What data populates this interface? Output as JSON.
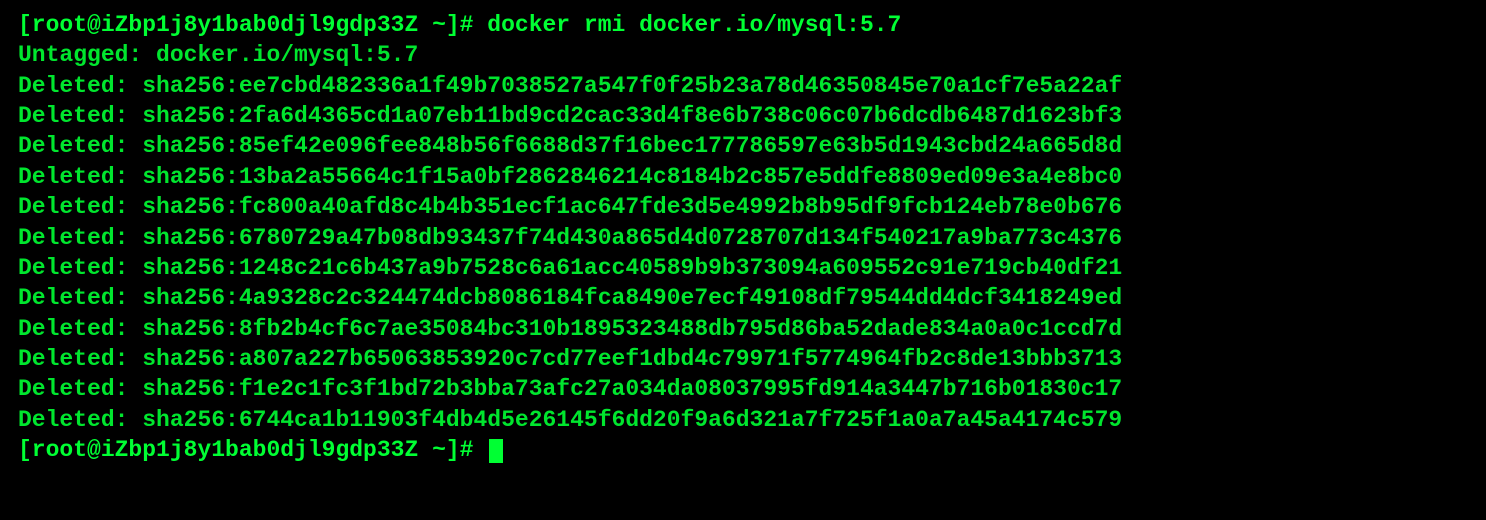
{
  "prompt": "[root@iZbp1j8y1bab0djl9gdp33Z ~]# ",
  "command": "docker rmi docker.io/mysql:5.7",
  "untagged_label": "Untagged: ",
  "untagged_value": "docker.io/mysql:5.7",
  "deleted_label": "Deleted: ",
  "deleted": [
    "sha256:ee7cbd482336a1f49b7038527a547f0f25b23a78d46350845e70a1cf7e5a22af",
    "sha256:2fa6d4365cd1a07eb11bd9cd2cac33d4f8e6b738c06c07b6dcdb6487d1623bf3",
    "sha256:85ef42e096fee848b56f6688d37f16bec177786597e63b5d1943cbd24a665d8d",
    "sha256:13ba2a55664c1f15a0bf2862846214c8184b2c857e5ddfe8809ed09e3a4e8bc0",
    "sha256:fc800a40afd8c4b4b351ecf1ac647fde3d5e4992b8b95df9fcb124eb78e0b676",
    "sha256:6780729a47b08db93437f74d430a865d4d0728707d134f540217a9ba773c4376",
    "sha256:1248c21c6b437a9b7528c6a61acc40589b9b373094a609552c91e719cb40df21",
    "sha256:4a9328c2c324474dcb8086184fca8490e7ecf49108df79544dd4dcf3418249ed",
    "sha256:8fb2b4cf6c7ae35084bc310b1895323488db795d86ba52dade834a0a0c1ccd7d",
    "sha256:a807a227b65063853920c7cd77eef1dbd4c79971f5774964fb2c8de13bbb3713",
    "sha256:f1e2c1fc3f1bd72b3bba73afc27a034da08037995fd914a3447b716b01830c17",
    "sha256:6744ca1b11903f4db4d5e26145f6dd20f9a6d321a7f725f1a0a7a45a4174c579"
  ]
}
